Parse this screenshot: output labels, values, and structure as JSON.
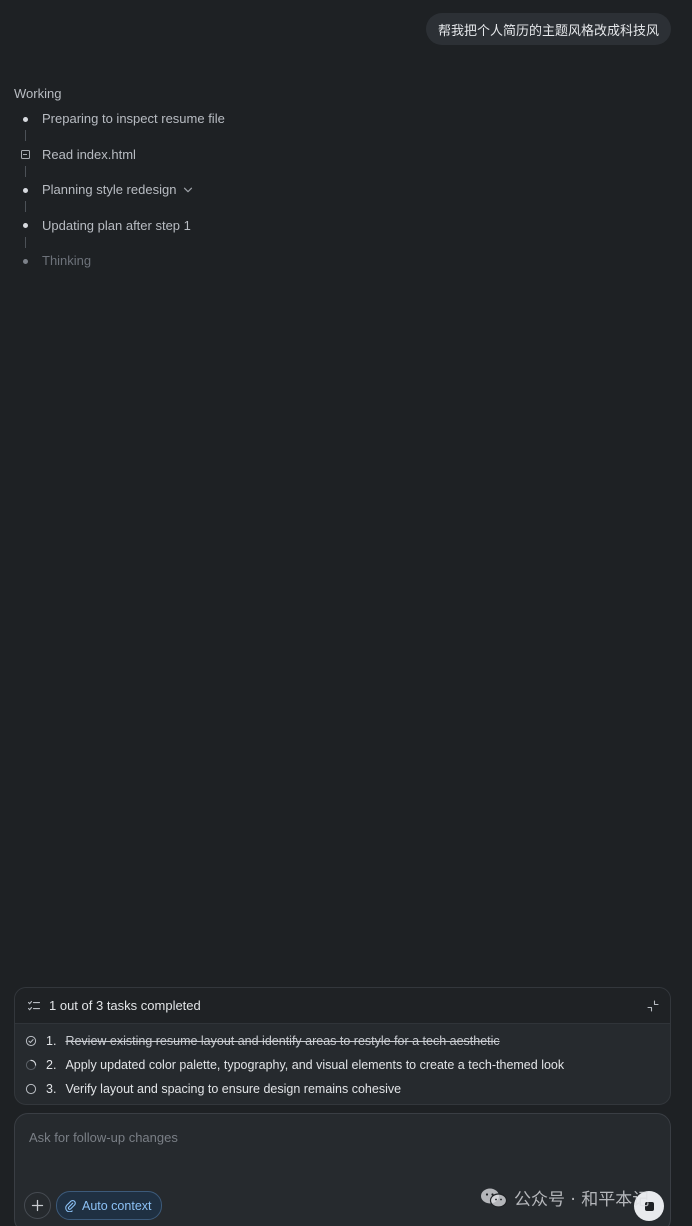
{
  "chat": {
    "user_message": "帮我把个人简历的主题风格改成科技风"
  },
  "working": {
    "label": "Working",
    "steps": [
      {
        "icon": "bullet-dot-icon",
        "label": "Preparing to inspect resume file"
      },
      {
        "icon": "file-icon",
        "label": "Read index.html"
      },
      {
        "icon": "bullet-dot-icon",
        "label": "Planning style redesign",
        "expandable": true
      },
      {
        "icon": "bullet-dot-icon",
        "label": "Updating plan after step 1"
      },
      {
        "icon": "bullet-dot-icon",
        "label": "Thinking",
        "active": true
      }
    ]
  },
  "tasks": {
    "summary": "1 out of 3 tasks completed",
    "items": [
      {
        "number": "1.",
        "text": "Review existing resume layout and identify areas to restyle for a tech aesthetic",
        "status": "completed"
      },
      {
        "number": "2.",
        "text": "Apply updated color palette, typography, and visual elements to create a tech-themed look",
        "status": "in-progress"
      },
      {
        "number": "3.",
        "text": "Verify layout and spacing to ensure design remains cohesive",
        "status": "pending"
      }
    ]
  },
  "composer": {
    "placeholder": "Ask for follow-up changes",
    "context_label": "Auto context"
  },
  "watermark": {
    "text": "公众号 · 和平本记"
  },
  "colors": {
    "background": "#1e2124",
    "accent": "#8cc1f5"
  }
}
